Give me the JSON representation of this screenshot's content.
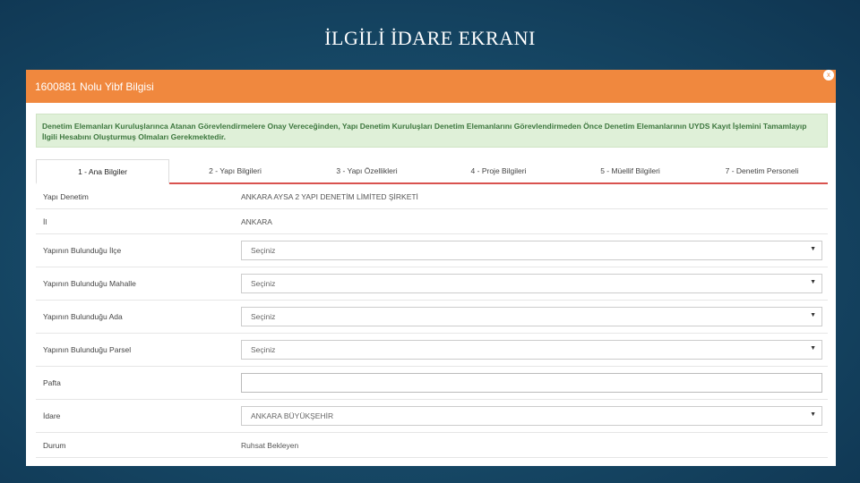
{
  "slide": {
    "title": "İLGİLİ İDARE EKRANI"
  },
  "window": {
    "title": "1600881 Nolu Yibf Bilgisi",
    "close_label": "x"
  },
  "alert": {
    "text": "Denetim Elemanları Kuruluşlarınca Atanan Görevlendirmelere Onay Vereceğinden, Yapı Denetim Kuruluşları Denetim Elemanlarını Görevlendirmeden Önce Denetim Elemanlarının UYDS Kayıt İşlemini Tamamlayıp İlgili Hesabını Oluşturmuş Olmaları Gerekmektedir."
  },
  "tabs": [
    {
      "label": "1 - Ana Bilgiler",
      "active": true
    },
    {
      "label": "2 - Yapı Bilgileri"
    },
    {
      "label": "3 - Yapı Özellikleri"
    },
    {
      "label": "4 - Proje Bilgileri"
    },
    {
      "label": "5 - Müellif Bilgileri"
    },
    {
      "label": "7 - Denetim Personeli"
    }
  ],
  "form": {
    "yapi_denetim": {
      "label": "Yapı Denetim",
      "value": "ANKARA AYSA 2 YAPI DENETİM LİMİTED ŞİRKETİ"
    },
    "il": {
      "label": "İl",
      "value": "ANKARA"
    },
    "ilce": {
      "label": "Yapının Bulunduğu İlçe",
      "value": "Seçiniz"
    },
    "mahalle": {
      "label": "Yapının Bulunduğu Mahalle",
      "value": "Seçiniz"
    },
    "ada": {
      "label": "Yapının Bulunduğu Ada",
      "value": "Seçiniz"
    },
    "parsel": {
      "label": "Yapının Bulunduğu Parsel",
      "value": "Seçiniz"
    },
    "pafta": {
      "label": "Pafta",
      "value": ""
    },
    "idare": {
      "label": "İdare",
      "value": "ANKARA BÜYÜKŞEHİR"
    },
    "durum": {
      "label": "Durum",
      "value": "Ruhsat Bekleyen"
    }
  },
  "icons": {
    "select_caret": "caret-down-icon",
    "close": "close-icon"
  },
  "colors": {
    "header": "#f0883e",
    "alert_bg": "#dff0d8",
    "alert_text": "#3c763d",
    "tab_underline": "#d9534f"
  }
}
